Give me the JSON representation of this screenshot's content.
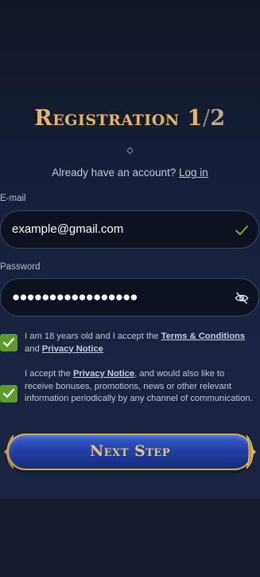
{
  "header": {
    "title_main": "Registration 1",
    "title_slash": "/",
    "title_total": "2"
  },
  "login_prompt": {
    "text": "Already have an account?",
    "link": "Log in"
  },
  "email": {
    "label": "E-mail",
    "value": "example@gmail.com",
    "status_icon": "checkmark-icon"
  },
  "password": {
    "label": "Password",
    "value": "●●●●●●●●●●●●●●●●●",
    "toggle_icon": "eye-slash-icon"
  },
  "age_consent": {
    "checked": true,
    "text_1": "I am 18 years old and I accept the ",
    "link_terms": "Terms & Conditions",
    "text_2": " and ",
    "link_privacy": "Privacy Notice"
  },
  "marketing_consent": {
    "checked": true,
    "text_1": "I accept the ",
    "link_privacy": "Privacy Notice",
    "text_2": ", and would also like to receive bonuses, promotions, news or other relevant information periodically by any channel of communication."
  },
  "next_button": {
    "label": "Next Step"
  },
  "colors": {
    "gold": "#e3b566",
    "check_green": "#5e9b2c",
    "button_blue": "#2241a6",
    "background": "#161c2e"
  }
}
